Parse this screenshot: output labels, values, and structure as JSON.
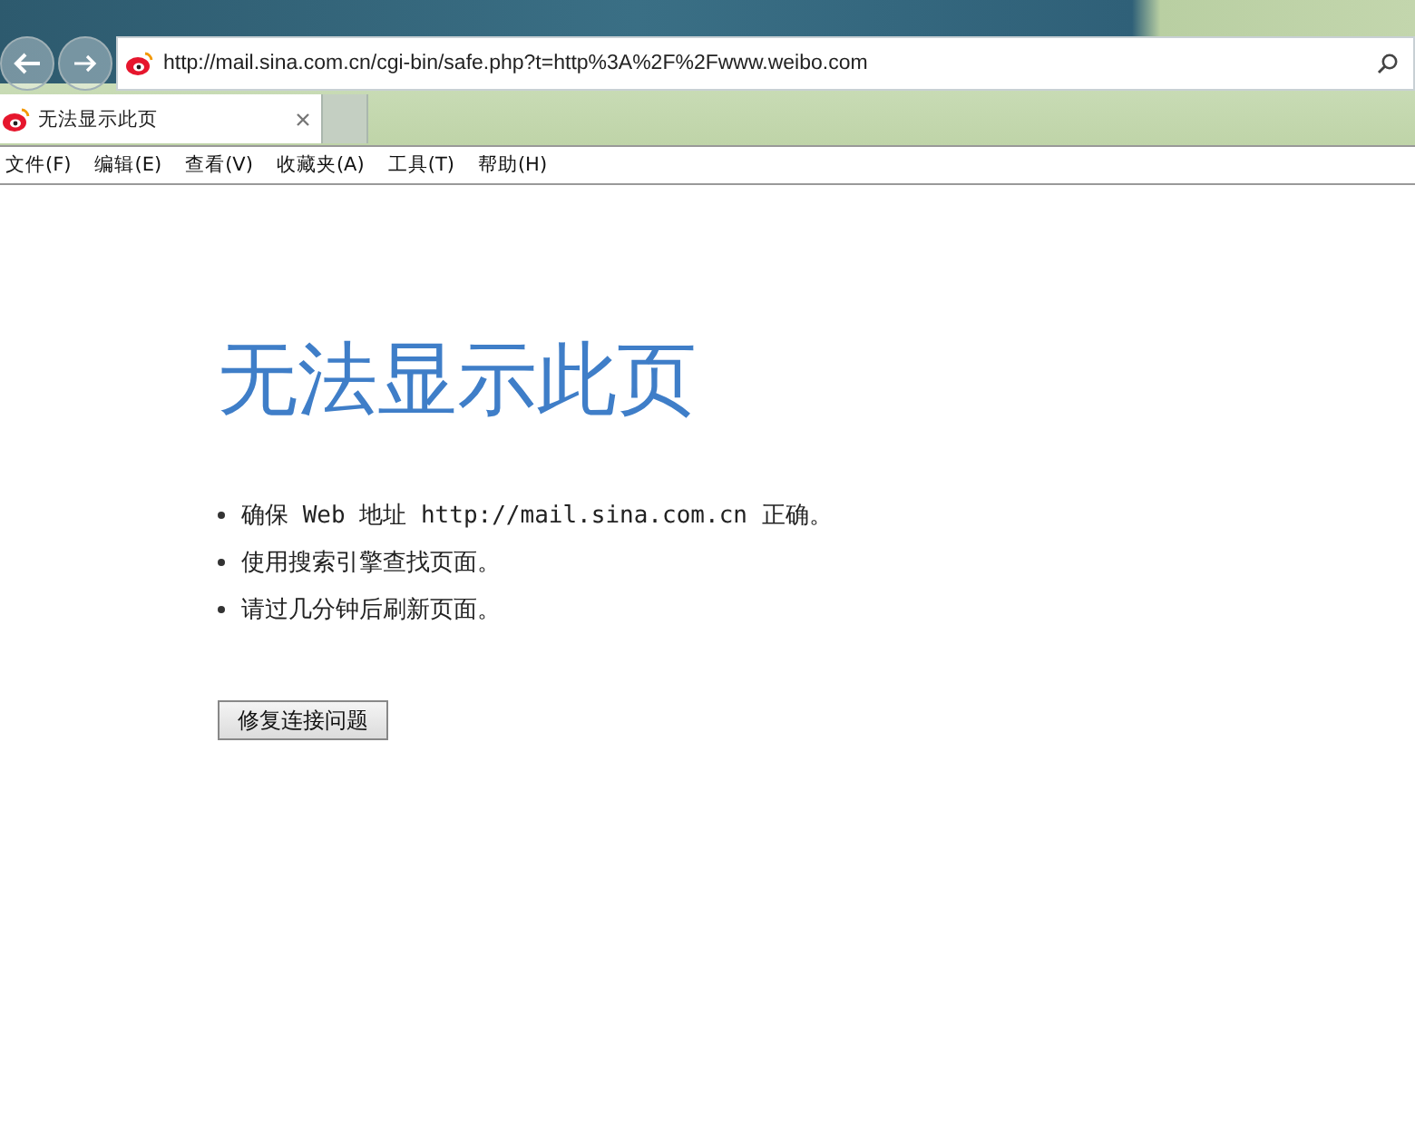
{
  "address_bar": {
    "url": "http://mail.sina.com.cn/cgi-bin/safe.php?t=http%3A%2F%2Fwww.weibo.com"
  },
  "tabs": [
    {
      "label": "无法显示此页",
      "selected": true
    }
  ],
  "menu": [
    "文件(F)",
    "编辑(E)",
    "查看(V)",
    "收藏夹(A)",
    "工具(T)",
    "帮助(H)"
  ],
  "page": {
    "heading": "无法显示此页",
    "bullets": [
      "确保 Web 地址 http://mail.sina.com.cn 正确。",
      "使用搜索引擎查找页面。",
      "请过几分钟后刷新页面。"
    ],
    "button": "修复连接问题"
  }
}
